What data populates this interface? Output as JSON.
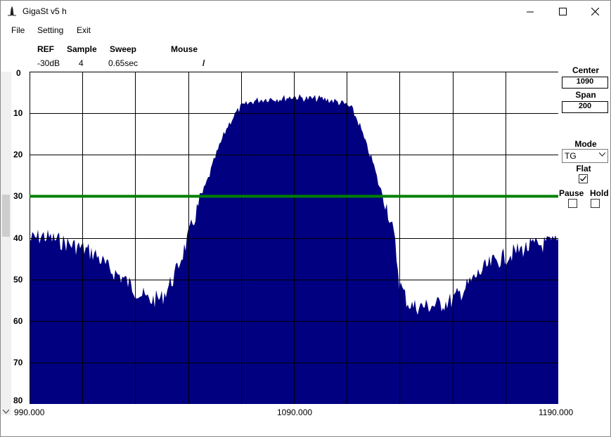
{
  "window": {
    "title": "GigaSt v5 h"
  },
  "menu": {
    "file": "File",
    "setting": "Setting",
    "exit": "Exit"
  },
  "header": {
    "ref_label": "REF",
    "ref_value": "-30dB",
    "sample_label": "Sample",
    "sample_value": "4",
    "sweep_label": "Sweep",
    "sweep_value": "0.65sec",
    "mouse_label": "Mouse",
    "mouse_value": "/"
  },
  "controls": {
    "center_label": "Center",
    "center_value": "1090",
    "span_label": "Span",
    "span_value": "200",
    "mode_label": "Mode",
    "mode_value": "TG",
    "flat_label": "Flat",
    "flat_checked": true,
    "pause_label": "Pause",
    "pause_checked": false,
    "hold_label": "Hold",
    "hold_checked": false
  },
  "chart_data": {
    "type": "area",
    "y_ticks": [
      "0",
      "10",
      "20",
      "30",
      "40",
      "50",
      "60",
      "70",
      "80"
    ],
    "x_ticks": [
      "990.000",
      "1090.000",
      "1190.000"
    ],
    "xlim": [
      990,
      1190
    ],
    "ylim": [
      0,
      80
    ],
    "y_inverted": true,
    "grid": true,
    "reference_line": {
      "y": 30,
      "color": "#008000"
    },
    "fill_color": "#000080",
    "x": [
      990,
      995,
      1000,
      1005,
      1010,
      1015,
      1020,
      1025,
      1030,
      1035,
      1040,
      1045,
      1050,
      1052,
      1055,
      1058,
      1060,
      1063,
      1065,
      1068,
      1070,
      1075,
      1080,
      1085,
      1090,
      1095,
      1100,
      1105,
      1110,
      1112,
      1115,
      1117,
      1120,
      1122,
      1125,
      1128,
      1130,
      1133,
      1135,
      1140,
      1145,
      1150,
      1155,
      1160,
      1165,
      1170,
      1175,
      1180,
      1185,
      1190
    ],
    "y": [
      40.5,
      39.5,
      40.5,
      41.5,
      42.5,
      44,
      47.5,
      49.5,
      52.5,
      55,
      54.5,
      49,
      40,
      36,
      30,
      25,
      21,
      16,
      13,
      10,
      8.5,
      7,
      6.5,
      6.5,
      6,
      6.5,
      6.5,
      7,
      8,
      9,
      13,
      17,
      22,
      27,
      32,
      40,
      51,
      55.5,
      56.5,
      56.5,
      56,
      55,
      52,
      48.5,
      46,
      44.5,
      43,
      42,
      41.5,
      41
    ]
  }
}
